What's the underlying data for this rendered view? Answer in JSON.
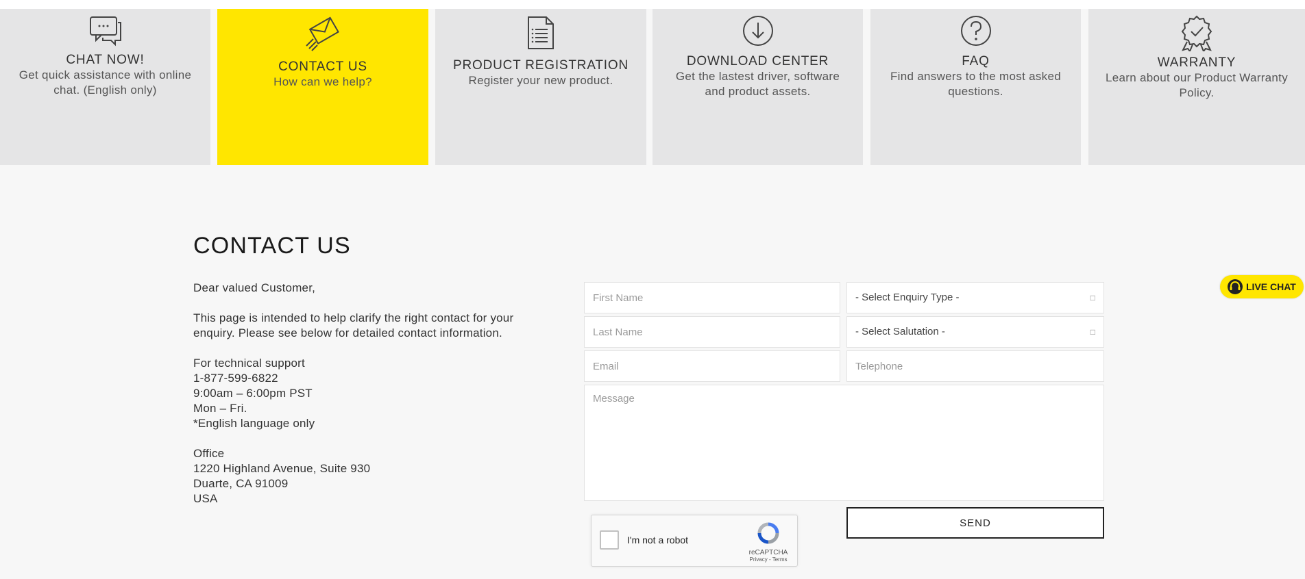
{
  "cards": [
    {
      "title": "CHAT NOW!",
      "desc_lines": [
        "Get quick assistance with online",
        "chat. (English only)"
      ],
      "icon": "chat-bubbles-icon",
      "active": false
    },
    {
      "title": "CONTACT US",
      "desc_lines": [
        "How can we help?"
      ],
      "icon": "envelope-send-icon",
      "active": true
    },
    {
      "title": "PRODUCT REGISTRATION",
      "desc_lines": [
        "Register your new product."
      ],
      "icon": "document-icon",
      "active": false
    },
    {
      "title": "DOWNLOAD CENTER",
      "desc_lines": [
        "Get the lastest driver, software",
        "and product assets."
      ],
      "icon": "download-arrow-icon",
      "active": false
    },
    {
      "title": "FAQ",
      "desc_lines": [
        "Find answers to the most asked",
        "questions."
      ],
      "icon": "question-circle-icon",
      "active": false
    },
    {
      "title": "WARRANTY",
      "desc_lines": [
        "Learn about our Product Warranty",
        "Policy."
      ],
      "icon": "award-badge-icon",
      "active": false
    }
  ],
  "contact": {
    "heading": "CONTACT US",
    "greeting": "Dear valued Customer,",
    "intro": [
      "This page is intended to help clarify the right contact for your",
      "enquiry. Please see below for detailed contact information."
    ],
    "support": [
      "For technical support",
      "1-877-599-6822",
      "9:00am – 6:00pm PST",
      "Mon – Fri.",
      "*English language only"
    ],
    "office": [
      "Office",
      "1220 Highland Avenue, Suite 930",
      "Duarte, CA 91009",
      "USA"
    ]
  },
  "form": {
    "first_name_placeholder": "First Name",
    "last_name_placeholder": "Last Name",
    "email_placeholder": "Email",
    "telephone_placeholder": "Telephone",
    "message_placeholder": "Message",
    "enquiry_select": "- Select Enquiry Type -",
    "salutation_select": "- Select Salutation -",
    "send_label": "SEND"
  },
  "captcha": {
    "label": "I'm not a robot",
    "brand": "reCAPTCHA",
    "links": "Privacy - Terms"
  },
  "live_chat": {
    "label": "LIVE CHAT",
    "icon": "headset-icon"
  },
  "colors": {
    "accent": "#ffe600",
    "card_bg": "#e5e5e6",
    "page_bg": "#f7f7f7"
  }
}
